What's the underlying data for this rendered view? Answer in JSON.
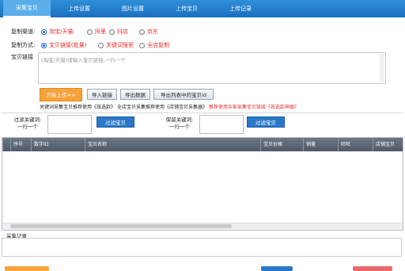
{
  "tabs": [
    "采集宝贝",
    "上传设置",
    "图片设置",
    "上传宝贝",
    "上传记录"
  ],
  "copy_channel": {
    "label": "复制渠道:",
    "options": [
      {
        "label": "淘宝/天猫",
        "selected": true
      },
      {
        "label": "阿里",
        "selected": false
      },
      {
        "label": "抖店",
        "selected": false
      },
      {
        "label": "京东",
        "selected": false
      }
    ]
  },
  "copy_mode": {
    "label": "复制方式:",
    "options": [
      {
        "label": "宝贝链接(批量)",
        "selected": true
      },
      {
        "label": "关键词搜索",
        "selected": false
      },
      {
        "label": "全店复制",
        "selected": false
      }
    ]
  },
  "links": {
    "label": "宝贝链接",
    "placeholder": "(淘宝/天猫)请输入宝贝链接,一行一个"
  },
  "buttons": {
    "start": "开始上传>>",
    "import": "导入链接",
    "export": "导出数据",
    "export_ids": "导出列表中的宝贝id"
  },
  "tips": {
    "part1": "关键词采集宝贝推荐使用《",
    "part2": "效选款》",
    "part3": " 全店宝贝采集推荐使用《店铺宝贝采集器》",
    "part4": " 推荐使用买家采集宝贝链接《",
    "part5": "效选款神器》"
  },
  "filter": {
    "exclude_label": "过滤关键词:",
    "exclude_hint": "一行一个",
    "exclude_button": "过滤宝贝",
    "keep_label": "保留关键词:",
    "keep_hint": "一行一个",
    "keep_button": "过滤宝贝"
  },
  "table": {
    "columns": [
      "序号",
      "数字ID",
      "宝贝名称",
      "宝贝价格",
      "销量",
      "旺旺",
      "店铺宝贝"
    ]
  },
  "log": {
    "label": "采集记录"
  },
  "colors": {
    "tabbar": "#1b6fc0",
    "accent": "#1a6dd4",
    "start_button": "#f7a23b",
    "red_text": "#e0302e"
  }
}
